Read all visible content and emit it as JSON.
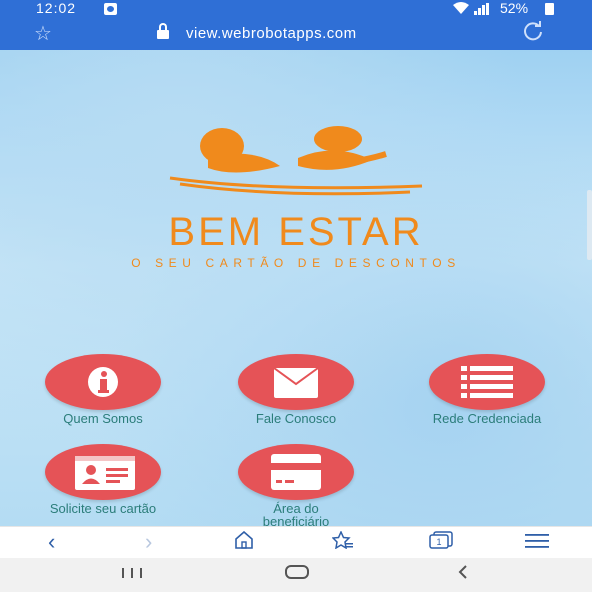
{
  "status_bar": {
    "time": "12:02",
    "battery_percent": "52%"
  },
  "url_bar": {
    "url": "view.webrobotapps.com"
  },
  "brand": {
    "name": "BEM ESTAR",
    "tagline": "O SEU CARTÃO DE DESCONTOS",
    "color": "#f08a1c"
  },
  "menu": {
    "items": [
      {
        "label": "Quem Somos",
        "icon": "info-icon"
      },
      {
        "label": "Fale Conosco",
        "icon": "envelope-icon"
      },
      {
        "label": "Rede Credenciada",
        "icon": "list-icon"
      },
      {
        "label": "Solicite seu cartão",
        "icon": "id-card-icon"
      },
      {
        "label": "Área do beneficiário",
        "icon": "credit-card-icon"
      }
    ],
    "button_color": "#e55357",
    "label_color": "#2b7d7a"
  },
  "browser_bar": {
    "icons": [
      "back-icon",
      "forward-icon",
      "home-icon",
      "bookmarks-icon",
      "tabs-icon",
      "menu-icon"
    ],
    "tab_count": "1"
  },
  "nav_bar": {
    "icons": [
      "recents-icon",
      "home-nav-icon",
      "back-nav-icon"
    ]
  }
}
